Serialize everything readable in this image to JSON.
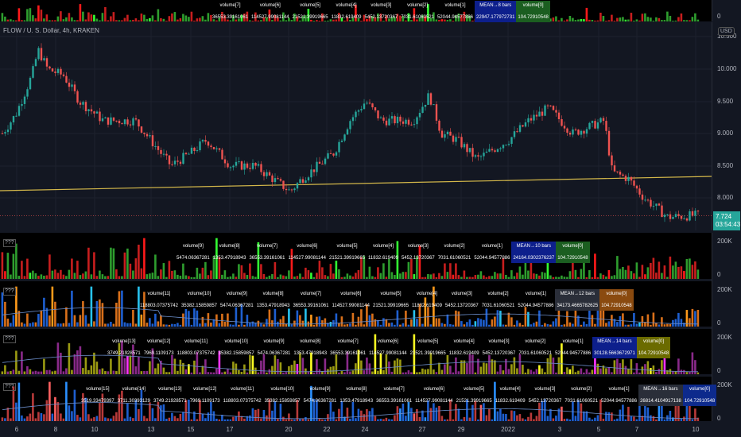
{
  "symbol_title": "FLOW / U. S. Dollar, 4h, KRAKEN",
  "currency": "USD",
  "last_price": "7.724",
  "countdown": "03:54:43",
  "indicator_label": "???",
  "price_axis": [
    "10.500",
    "10.000",
    "9.500",
    "9.000",
    "8.500",
    "8.000"
  ],
  "volume_axis": [
    "200K",
    "0"
  ],
  "date_axis": [
    "6",
    "8",
    "10",
    "13",
    "15",
    "17",
    "20",
    "22",
    "24",
    "27",
    "29",
    "2022",
    "3",
    "5",
    "7",
    "10"
  ],
  "colors": {
    "up": "#26a69a",
    "down": "#ef5350",
    "trendline": "#d4b84a",
    "mean_blue": "#0d1f8c",
    "mean_gray": "#2a2e39",
    "vol0_green": "#1b5e20",
    "vol0_orange": "#8a4a0f",
    "vol0_olive": "#6b6b00",
    "vol0_blue": "#0d2a8c"
  },
  "tables": [
    {
      "mean_header": "MEAN→8 bars",
      "mean_value": "22947.177972731",
      "cols": [
        {
          "h": "volume[7]",
          "v": "36553.39161061"
        },
        {
          "h": "volume[6]",
          "v": "114527.99081144"
        },
        {
          "h": "volume[5]",
          "v": "21521.39919665"
        },
        {
          "h": "volume[4]",
          "v": "11832.619409"
        },
        {
          "h": "volume[3]",
          "v": "5452.13720367"
        },
        {
          "h": "volume[2]",
          "v": "7031.61060521"
        },
        {
          "h": "volume[1]",
          "v": "52044.94577886"
        }
      ],
      "vol0_header": "volume[0]",
      "vol0_value": "104.72910548"
    },
    {
      "mean_header": "MEAN→10 bars",
      "mean_value": "24164.0302376237",
      "cols": [
        {
          "h": "volume[9]",
          "v": "5474.06367281"
        },
        {
          "h": "volume[8]",
          "v": "1353.47918943"
        },
        {
          "h": "volume[7]",
          "v": "36553.39161061"
        },
        {
          "h": "volume[6]",
          "v": "114527.99081144"
        },
        {
          "h": "volume[5]",
          "v": "21521.39919665"
        },
        {
          "h": "volume[4]",
          "v": "11832.619409"
        },
        {
          "h": "volume[3]",
          "v": "5452.13720367"
        },
        {
          "h": "volume[2]",
          "v": "7031.61060521"
        },
        {
          "h": "volume[1]",
          "v": "52044.94577886"
        }
      ],
      "vol0_header": "volume[0]",
      "vol0_value": "104.72910548"
    },
    {
      "mean_header": "MEAN→12 bars",
      "mean_value": "34173.4665782625",
      "cols": [
        {
          "h": "volume[11]",
          "v": "118803.07375742"
        },
        {
          "h": "volume[10]",
          "v": "35382.15859857"
        },
        {
          "h": "volume[9]",
          "v": "5474.06367281"
        },
        {
          "h": "volume[8]",
          "v": "1353.47918943"
        },
        {
          "h": "volume[7]",
          "v": "36553.39161061"
        },
        {
          "h": "volume[6]",
          "v": "114527.99081144"
        },
        {
          "h": "volume[5]",
          "v": "21521.39919665"
        },
        {
          "h": "volume[4]",
          "v": "11832.619409"
        },
        {
          "h": "volume[3]",
          "v": "5452.13720367"
        },
        {
          "h": "volume[2]",
          "v": "7031.61060521"
        },
        {
          "h": "volume[1]",
          "v": "52044.94577886"
        }
      ],
      "vol0_header": "volume[0]",
      "vol0_value": "104.72910548"
    },
    {
      "mean_header": "MEAN→14 bars",
      "mean_value": "30128.5663672971",
      "cols": [
        {
          "h": "volume[13]",
          "v": "3749.21928571"
        },
        {
          "h": "volume[12]",
          "v": "7969.1109173"
        },
        {
          "h": "volume[11]",
          "v": "118803.07375742"
        },
        {
          "h": "volume[10]",
          "v": "35382.15859857"
        },
        {
          "h": "volume[9]",
          "v": "5474.06367281"
        },
        {
          "h": "volume[8]",
          "v": "1353.47918943"
        },
        {
          "h": "volume[7]",
          "v": "36553.39161061"
        },
        {
          "h": "volume[6]",
          "v": "114527.99081144"
        },
        {
          "h": "volume[5]",
          "v": "21521.39919665"
        },
        {
          "h": "volume[4]",
          "v": "11832.619409"
        },
        {
          "h": "volume[3]",
          "v": "5452.13720367"
        },
        {
          "h": "volume[2]",
          "v": "7031.61060521"
        },
        {
          "h": "volume[1]",
          "v": "52044.94577886"
        }
      ],
      "vol0_header": "volume[0]",
      "vol0_value": "104.72910548"
    },
    {
      "mean_header": "MEAN→16 bars",
      "mean_value": "26814.4104917138",
      "cols": [
        {
          "h": "volume[15]",
          "v": "3519.33479397"
        },
        {
          "h": "volume[14]",
          "v": "3711.30393129"
        },
        {
          "h": "volume[13]",
          "v": "3749.21928571"
        },
        {
          "h": "volume[12]",
          "v": "7969.1109173"
        },
        {
          "h": "volume[11]",
          "v": "118803.07375742"
        },
        {
          "h": "volume[10]",
          "v": "35382.15859857"
        },
        {
          "h": "volume[9]",
          "v": "5474.06367281"
        },
        {
          "h": "volume[8]",
          "v": "1353.47918943"
        },
        {
          "h": "volume[7]",
          "v": "36553.39161061"
        },
        {
          "h": "volume[6]",
          "v": "114527.99081144"
        },
        {
          "h": "volume[5]",
          "v": "21521.39919665"
        },
        {
          "h": "volume[4]",
          "v": "11832.619409"
        },
        {
          "h": "volume[3]",
          "v": "5452.13720367"
        },
        {
          "h": "volume[2]",
          "v": "7031.61060521"
        },
        {
          "h": "volume[1]",
          "v": "52044.94577886"
        }
      ],
      "vol0_header": "volume[0]",
      "vol0_value": "104.72910548"
    }
  ]
}
